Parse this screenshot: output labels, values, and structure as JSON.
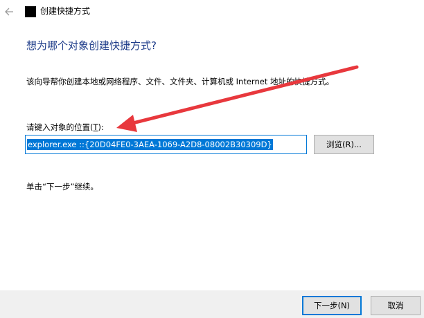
{
  "window": {
    "title": "创建快捷方式",
    "back_icon": "arrow-left-icon",
    "app_icon": "shortcut-app-icon"
  },
  "wizard": {
    "heading": "想为哪个对象创建快捷方式?",
    "description": "该向导帮你创建本地或网络程序、文件、文件夹、计算机或 Internet 地址的快捷方式。",
    "location_label_prefix": "请键入对象的位置(",
    "location_label_accesskey": "T",
    "location_label_suffix": "):",
    "location_value": "explorer.exe ::{20D04FE0-3AEA-1069-A2D8-08002B30309D}",
    "browse_label": "浏览(R)...",
    "hint": "单击“下一步”继续。"
  },
  "footer": {
    "next_label": "下一步(N)",
    "cancel_label": "取消"
  },
  "colors": {
    "accent": "#0078d7",
    "heading": "#1f3d8a",
    "annotation_arrow": "#e8383d"
  }
}
